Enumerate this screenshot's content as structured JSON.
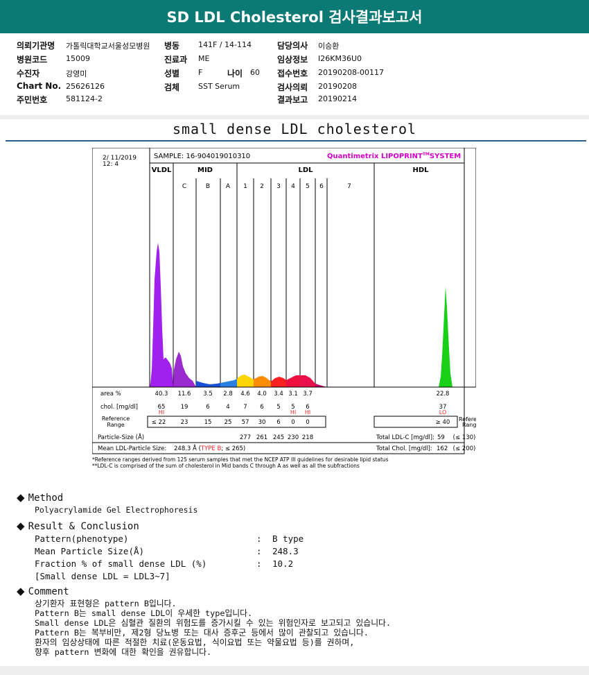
{
  "header": {
    "title": "SD LDL Cholesterol 검사결과보고서"
  },
  "info": {
    "c1": [
      {
        "label": "의뢰기관명",
        "value": "가톨릭대학교서울성모병원"
      },
      {
        "label": "병원코드",
        "value": "15009"
      },
      {
        "label": "수진자",
        "value": "강영미"
      },
      {
        "label": "Chart No.",
        "value": "25626126"
      },
      {
        "label": "주민번호",
        "value": "581124-2"
      }
    ],
    "c2": [
      {
        "label": "병동",
        "value": "141F / 14-114"
      },
      {
        "label": "진료과",
        "value": "ME"
      },
      {
        "label": "성별",
        "value": "F"
      },
      {
        "label": "검체",
        "value": "SST Serum"
      }
    ],
    "age": {
      "label": "나이",
      "value": "60"
    },
    "c3": [
      {
        "label": "담당의사",
        "value": "이승환"
      },
      {
        "label": "임상정보",
        "value": "I26KM36U0"
      },
      {
        "label": "접수번호",
        "value": "20190208-00117"
      },
      {
        "label": "검사의뢰",
        "value": "20190208"
      },
      {
        "label": "결과보고",
        "value": "20190214"
      }
    ]
  },
  "report_title": "small dense LDL cholesterol",
  "chart": {
    "datetime_line1": "2/ 11/2019",
    "datetime_line2": "12: 4",
    "sample": "SAMPLE:   16-904019010310",
    "system": "Quantimetrix LIPOPRINT",
    "system_tm": "TM",
    "system_suffix": "SYSTEM",
    "groups": [
      "VLDL",
      "MID",
      "LDL",
      "HDL"
    ],
    "bands": [
      "C",
      "B",
      "A",
      "1",
      "2",
      "3",
      "4",
      "5",
      "6",
      "7"
    ],
    "row_area_label": "area %",
    "area": [
      "40.3",
      "11.6",
      "3.5",
      "2.8",
      "4.6",
      "4.0",
      "3.4",
      "3.1",
      "3.7"
    ],
    "area_hdl": "22.8",
    "row_chol_label": "chol. [mg/dl]",
    "chol": [
      "65",
      "19",
      "6",
      "4",
      "7",
      "6",
      "5",
      "5",
      "6"
    ],
    "chol_hdl": "37",
    "flag_vldl": "HI",
    "flag_b5": "HI",
    "flag_b6": "HI",
    "flag_hdl": "LO",
    "ref_label_1": "Reference",
    "ref_label_2": "Range",
    "ref": [
      "≤ 22",
      "23",
      "15",
      "25",
      "57",
      "30",
      "6",
      "0",
      "0"
    ],
    "ref_hdl": "≥ 40",
    "ref_right_1": "Reference",
    "ref_right_2": "Range",
    "particle_label": "Particle-Size (Å)",
    "particle": [
      "277",
      "261",
      "245",
      "230",
      "218"
    ],
    "total_ldl_label": "Total LDL-C [mg/dl]:",
    "total_ldl_value": "59",
    "total_ldl_ref": "(≤ 130)",
    "mean_label": "Mean LDL-Particle Size:",
    "mean_value": "248.3 Å",
    "mean_type_open": "(",
    "mean_type": "TYPE B",
    "mean_type_close": "; ≤ 265)",
    "total_chol_label": "Total Chol. [mg/dl]:",
    "total_chol_value": "162",
    "total_chol_ref": "(≤ 200)",
    "footnote1": "*Reference ranges derived from 125 serum samples that met the NCEP ATP III guidelines for desirable lipid status",
    "footnote2": "**LDL-C is comprised of the sum of cholesterol in Mid bands C through A as well as all the subfractions",
    "colors": {
      "vldl": "#a020f0",
      "mid_c": "#9b2bd1",
      "mid_b": "#1a4fd6",
      "mid_a": "#2a7fe0",
      "ldl1": "#ffd400",
      "ldl2": "#ff8c00",
      "ldl3": "#ff2020",
      "ldl4": "#ee1040",
      "hdl": "#19d019",
      "brand": "#d200c8"
    }
  },
  "method": {
    "heading": "Method",
    "text": "Polyacrylamide Gel Electrophoresis"
  },
  "result": {
    "heading": "Result & Conclusion",
    "rows": [
      {
        "label": "Pattern(phenotype)",
        "value": "B type"
      },
      {
        "label": "Mean Particle Size(Å)",
        "value": "248.3"
      },
      {
        "label": "Fraction % of small dense LDL (%)",
        "value": "10.2"
      }
    ],
    "colon": ":",
    "note": "[Small dense LDL = LDL3~7]"
  },
  "comment": {
    "heading": "Comment",
    "lines": [
      "상기환자 표현형은 pattern B입니다.",
      "Pattern B는 small dense LDL이 우세한 type입니다.",
      "Small dense LDL은 심혈관 질환의 위험도를 증가시킬 수 있는 위험인자로 보고되고 있습니다.",
      "Pattern B는 복부비만, 제2형 당뇨병 또는 대사 증후군 등에서 많이 관찰되고 있습니다.",
      "환자의 임상상태에 따른 적절한 치료(운동요법, 식이요법 또는 약물요법 등)를 권하며,",
      "향후 pattern 변화에 대한 확인을 권유합니다."
    ]
  },
  "icons": {
    "bullet": "diamond-bullet-icon"
  }
}
